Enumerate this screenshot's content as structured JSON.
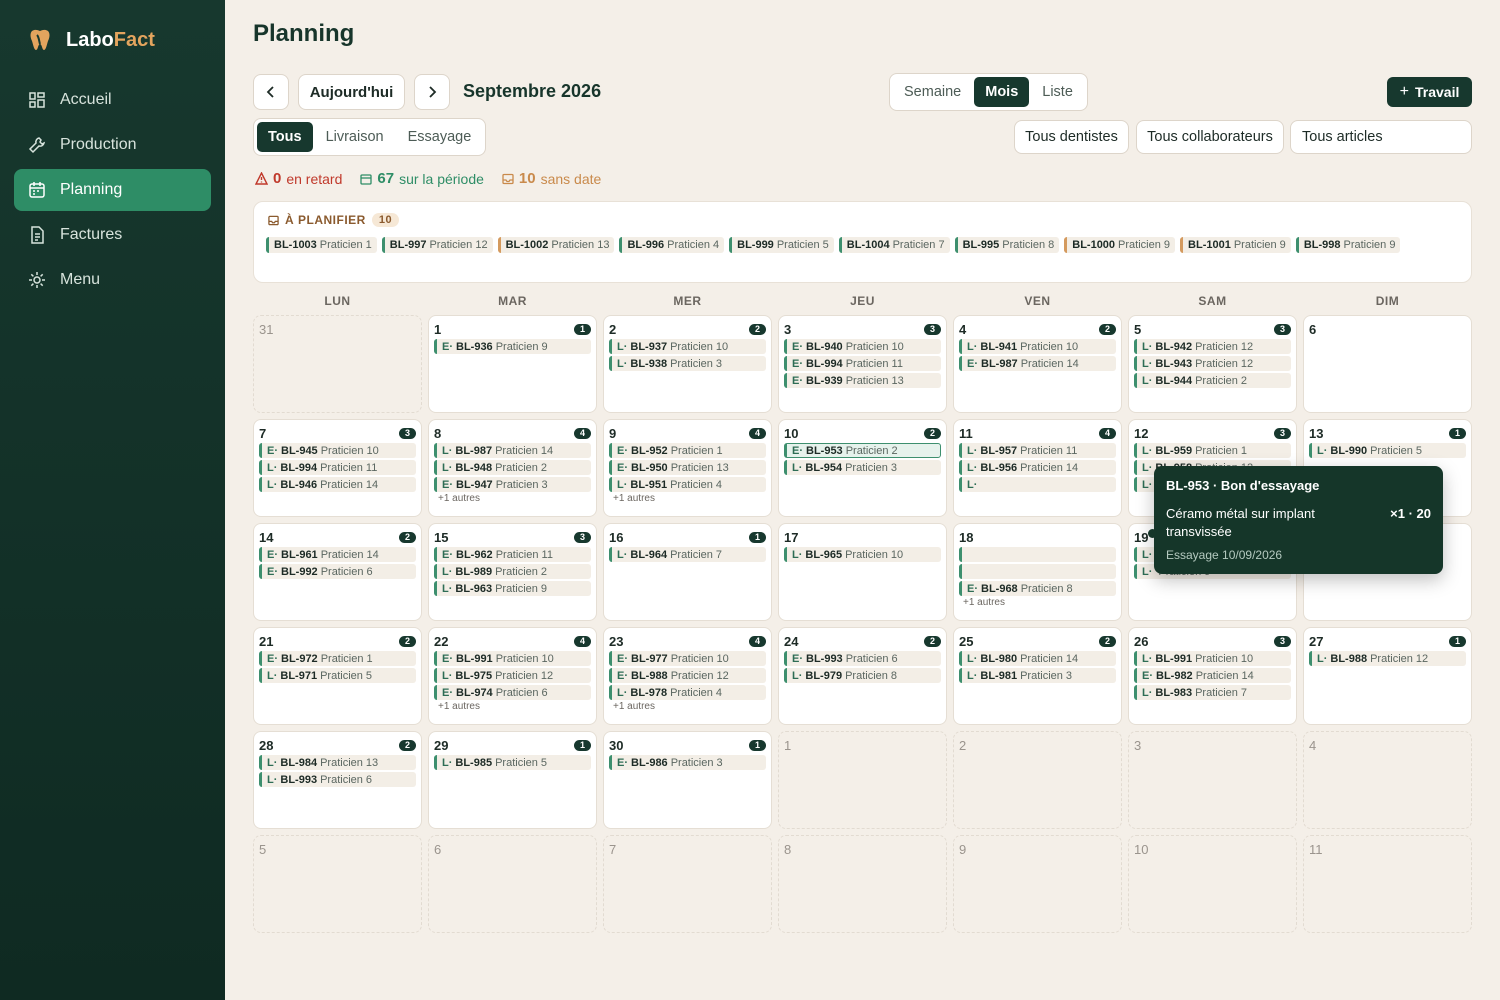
{
  "app": {
    "name_part1": "Labo",
    "name_part2": "Fact",
    "accent": "#2e8d66"
  },
  "nav": [
    {
      "label": "Accueil",
      "icon": "dashboard-icon",
      "active": false
    },
    {
      "label": "Production",
      "icon": "wrench-icon",
      "active": false
    },
    {
      "label": "Planning",
      "icon": "calendar-icon",
      "active": true
    },
    {
      "label": "Factures",
      "icon": "document-icon",
      "active": false
    },
    {
      "label": "Menu",
      "icon": "gear-icon",
      "active": false
    }
  ],
  "page": {
    "title": "Planning"
  },
  "toolbar": {
    "today": "Aujourd'hui",
    "month": "Septembre 2026",
    "new_job": "Travail"
  },
  "views": {
    "options": [
      "Semaine",
      "Mois",
      "Liste"
    ],
    "selected": "Mois"
  },
  "filters": {
    "types": [
      "Tous",
      "Livraison",
      "Essayage"
    ],
    "selected": "Tous",
    "dentists": "Tous dentistes",
    "collaborators": "Tous collaborateurs",
    "articles": "Tous articles"
  },
  "stats": {
    "late": {
      "value": "0",
      "label": "en retard"
    },
    "period": {
      "value": "67",
      "label": "sur la période"
    },
    "undated": {
      "value": "10",
      "label": "sans date"
    }
  },
  "to_plan": {
    "label": "À PLANIFIER",
    "count": "10",
    "items": [
      {
        "id": "BL-1003",
        "praticien": "Praticien 1",
        "color": "green"
      },
      {
        "id": "BL-997",
        "praticien": "Praticien 12",
        "color": "green"
      },
      {
        "id": "BL-1002",
        "praticien": "Praticien 13",
        "color": "orange"
      },
      {
        "id": "BL-996",
        "praticien": "Praticien 4",
        "color": "green"
      },
      {
        "id": "BL-999",
        "praticien": "Praticien 5",
        "color": "green"
      },
      {
        "id": "BL-1004",
        "praticien": "Praticien 7",
        "color": "green"
      },
      {
        "id": "BL-995",
        "praticien": "Praticien 8",
        "color": "green"
      },
      {
        "id": "BL-1000",
        "praticien": "Praticien 9",
        "color": "orange"
      },
      {
        "id": "BL-1001",
        "praticien": "Praticien 9",
        "color": "orange"
      },
      {
        "id": "BL-998",
        "praticien": "Praticien 9",
        "color": "green"
      }
    ]
  },
  "weekdays": [
    "LUN",
    "MAR",
    "MER",
    "JEU",
    "VEN",
    "SAM",
    "DIM"
  ],
  "calendar": [
    {
      "day": "31",
      "other": true,
      "jobs": []
    },
    {
      "day": "1",
      "badge": "1",
      "jobs": [
        [
          "E·",
          "BL-936",
          "Praticien 9"
        ]
      ]
    },
    {
      "day": "2",
      "badge": "2",
      "jobs": [
        [
          "L·",
          "BL-937",
          "Praticien 10"
        ],
        [
          "L·",
          "BL-938",
          "Praticien 3"
        ]
      ]
    },
    {
      "day": "3",
      "badge": "3",
      "jobs": [
        [
          "E·",
          "BL-940",
          "Praticien 10"
        ],
        [
          "E·",
          "BL-994",
          "Praticien 11"
        ],
        [
          "E·",
          "BL-939",
          "Praticien 13"
        ]
      ]
    },
    {
      "day": "4",
      "badge": "2",
      "jobs": [
        [
          "L·",
          "BL-941",
          "Praticien 10"
        ],
        [
          "E·",
          "BL-987",
          "Praticien 14"
        ]
      ]
    },
    {
      "day": "5",
      "badge": "3",
      "jobs": [
        [
          "L·",
          "BL-942",
          "Praticien 12"
        ],
        [
          "L·",
          "BL-943",
          "Praticien 12"
        ],
        [
          "L·",
          "BL-944",
          "Praticien 2"
        ]
      ]
    },
    {
      "day": "6",
      "jobs": []
    },
    {
      "day": "7",
      "badge": "3",
      "jobs": [
        [
          "E·",
          "BL-945",
          "Praticien 10"
        ],
        [
          "L·",
          "BL-994",
          "Praticien 11"
        ],
        [
          "L·",
          "BL-946",
          "Praticien 14"
        ]
      ]
    },
    {
      "day": "8",
      "badge": "4",
      "jobs": [
        [
          "L·",
          "BL-987",
          "Praticien 14"
        ],
        [
          "L·",
          "BL-948",
          "Praticien 2"
        ],
        [
          "E·",
          "BL-947",
          "Praticien 3"
        ]
      ],
      "more": "+1 autres"
    },
    {
      "day": "9",
      "badge": "4",
      "jobs": [
        [
          "E·",
          "BL-952",
          "Praticien 1"
        ],
        [
          "E·",
          "BL-950",
          "Praticien 13"
        ],
        [
          "L·",
          "BL-951",
          "Praticien 4"
        ]
      ],
      "more": "+1 autres"
    },
    {
      "day": "10",
      "badge": "2",
      "jobs": [
        [
          "E·",
          "BL-953",
          "Praticien 2",
          "hl"
        ],
        [
          "L·",
          "BL-954",
          "Praticien 3"
        ]
      ]
    },
    {
      "day": "11",
      "badge": "4",
      "jobs": [
        [
          "L·",
          "BL-957",
          "Praticien 11"
        ],
        [
          "L·",
          "BL-956",
          "Praticien 14"
        ],
        [
          "L·",
          "",
          ""
        ]
      ]
    },
    {
      "day": "12",
      "badge": "3",
      "jobs": [
        [
          "L·",
          "BL-959",
          "Praticien 1"
        ],
        [
          "L·",
          "BL-958",
          "Praticien 12"
        ],
        [
          "L·",
          "",
          "Praticien 4"
        ]
      ]
    },
    {
      "day": "13",
      "badge": "1",
      "jobs": [
        [
          "L·",
          "BL-990",
          "Praticien 5"
        ]
      ]
    },
    {
      "day": "14",
      "badge": "2",
      "jobs": [
        [
          "E·",
          "BL-961",
          "Praticien 14"
        ],
        [
          "E·",
          "BL-992",
          "Praticien 6"
        ]
      ]
    },
    {
      "day": "15",
      "badge": "3",
      "jobs": [
        [
          "E·",
          "BL-962",
          "Praticien 11"
        ],
        [
          "L·",
          "BL-989",
          "Praticien 2"
        ],
        [
          "L·",
          "BL-963",
          "Praticien 9"
        ]
      ]
    },
    {
      "day": "16",
      "badge": "1",
      "jobs": [
        [
          "L·",
          "BL-964",
          "Praticien 7"
        ]
      ]
    },
    {
      "day": "17",
      "jobs": [
        [
          "L·",
          "BL-965",
          "Praticien 10"
        ]
      ]
    },
    {
      "day": "18",
      "jobs": [
        [
          "",
          "",
          ""
        ],
        [
          "",
          "",
          ""
        ],
        [
          "E·",
          "BL-968",
          "Praticien 8"
        ]
      ],
      "more": "+1 autres"
    },
    {
      "day": "19",
      "badge": "2",
      "jobs": [
        [
          "L·",
          "",
          "Praticien 2"
        ],
        [
          "L·",
          "",
          "Praticien 9"
        ]
      ]
    },
    {
      "day": "20",
      "jobs": []
    },
    {
      "day": "21",
      "badge": "2",
      "jobs": [
        [
          "E·",
          "BL-972",
          "Praticien 1"
        ],
        [
          "L·",
          "BL-971",
          "Praticien 5"
        ]
      ]
    },
    {
      "day": "22",
      "badge": "4",
      "jobs": [
        [
          "E·",
          "BL-991",
          "Praticien 10"
        ],
        [
          "L·",
          "BL-975",
          "Praticien 12"
        ],
        [
          "E·",
          "BL-974",
          "Praticien 6"
        ]
      ],
      "more": "+1 autres"
    },
    {
      "day": "23",
      "badge": "4",
      "jobs": [
        [
          "E·",
          "BL-977",
          "Praticien 10"
        ],
        [
          "E·",
          "BL-988",
          "Praticien 12"
        ],
        [
          "L·",
          "BL-978",
          "Praticien 4"
        ]
      ],
      "more": "+1 autres"
    },
    {
      "day": "24",
      "badge": "2",
      "jobs": [
        [
          "E·",
          "BL-993",
          "Praticien 6"
        ],
        [
          "L·",
          "BL-979",
          "Praticien 8"
        ]
      ]
    },
    {
      "day": "25",
      "badge": "2",
      "jobs": [
        [
          "L·",
          "BL-980",
          "Praticien 14"
        ],
        [
          "L·",
          "BL-981",
          "Praticien 3"
        ]
      ]
    },
    {
      "day": "26",
      "badge": "3",
      "jobs": [
        [
          "L·",
          "BL-991",
          "Praticien 10"
        ],
        [
          "E·",
          "BL-982",
          "Praticien 14"
        ],
        [
          "L·",
          "BL-983",
          "Praticien 7"
        ]
      ]
    },
    {
      "day": "27",
      "badge": "1",
      "jobs": [
        [
          "L·",
          "BL-988",
          "Praticien 12"
        ]
      ]
    },
    {
      "day": "28",
      "badge": "2",
      "jobs": [
        [
          "L·",
          "BL-984",
          "Praticien 13"
        ],
        [
          "L·",
          "BL-993",
          "Praticien 6"
        ]
      ]
    },
    {
      "day": "29",
      "badge": "1",
      "jobs": [
        [
          "L·",
          "BL-985",
          "Praticien 5"
        ]
      ]
    },
    {
      "day": "30",
      "badge": "1",
      "jobs": [
        [
          "E·",
          "BL-986",
          "Praticien 3"
        ]
      ]
    },
    {
      "day": "1",
      "other": true,
      "jobs": []
    },
    {
      "day": "2",
      "other": true,
      "jobs": []
    },
    {
      "day": "3",
      "other": true,
      "jobs": []
    },
    {
      "day": "4",
      "other": true,
      "jobs": []
    },
    {
      "day": "5",
      "other": true,
      "jobs": []
    },
    {
      "day": "6",
      "other": true,
      "jobs": []
    },
    {
      "day": "7",
      "other": true,
      "jobs": []
    },
    {
      "day": "8",
      "other": true,
      "jobs": []
    },
    {
      "day": "9",
      "other": true,
      "jobs": []
    },
    {
      "day": "10",
      "other": true,
      "jobs": []
    },
    {
      "day": "11",
      "other": true,
      "jobs": []
    }
  ],
  "tooltip": {
    "title": "BL-953 · Bon d'essayage",
    "description": "Céramo métal sur implant transvissée",
    "quantity": "×1 · 20",
    "date": "Essayage 10/09/2026"
  }
}
